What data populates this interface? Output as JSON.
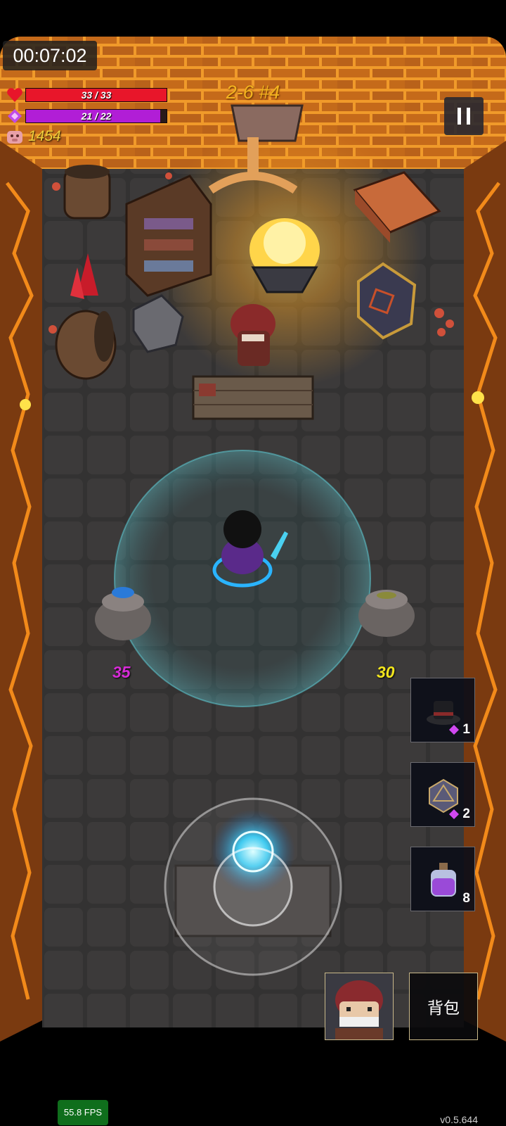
{
  "hud": {
    "timer": "00:07:02",
    "hp": {
      "text": "33 / 33",
      "current": 33,
      "max": 33,
      "color": "#e8162a"
    },
    "mana": {
      "text": "21 / 22",
      "current": 21,
      "max": 22,
      "color": "#b11ed6"
    },
    "coins": "1454",
    "level": "2-6 #4"
  },
  "damage_numbers": [
    {
      "text": "35",
      "color": "#d62bd6"
    },
    {
      "text": "30",
      "color": "#f2e51d"
    }
  ],
  "items": [
    {
      "icon": "top-hat-icon",
      "count": "1",
      "cost_gem": true
    },
    {
      "icon": "d20-dice-icon",
      "count": "2",
      "cost_gem": true
    },
    {
      "icon": "purple-potion-icon",
      "count": "8",
      "cost_gem": false
    }
  ],
  "bag_label": "背包",
  "fps": "55.8 FPS",
  "version": "v0.5.644",
  "colors": {
    "floor": "#3a3838",
    "lava": "#f08a1c",
    "wall": "#c8711e"
  }
}
